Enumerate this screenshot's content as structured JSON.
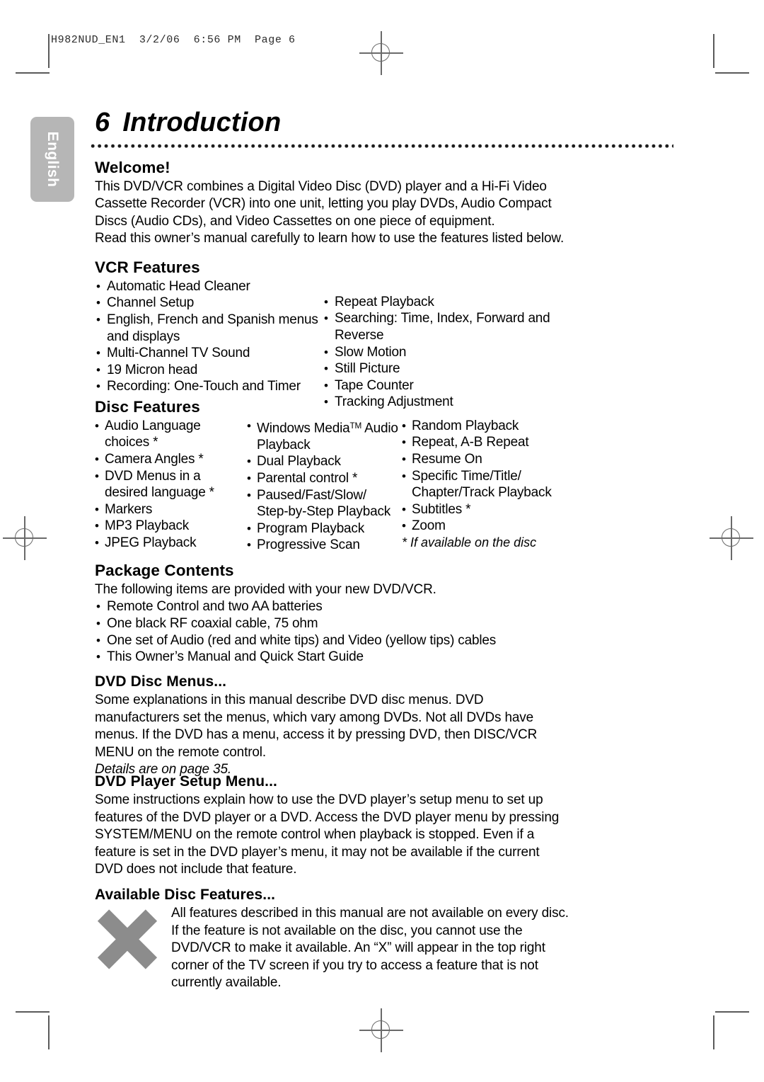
{
  "print_slug": "H982NUD_EN1  3/2/06  6:56 PM  Page 6",
  "language_tab": "English",
  "page": {
    "number": "6",
    "title": "Introduction"
  },
  "sections": {
    "welcome": {
      "heading": "Welcome!",
      "paragraph1": "This DVD/VCR combines a Digital Video Disc (DVD) player and a Hi-Fi Video Cassette Recorder (VCR) into one unit, letting you play DVDs, Audio Compact Discs (Audio CDs), and Video Cassettes on one piece of equipment.",
      "paragraph2": "Read this owner’s manual carefully to learn how to use the features listed below."
    },
    "vcr_features": {
      "heading": "VCR Features",
      "column_left": [
        "Automatic Head Cleaner",
        "Channel Setup",
        "English, French and Spanish menus and displays",
        "Multi-Channel TV Sound",
        "19 Micron head",
        "Recording: One-Touch and Timer"
      ],
      "column_right": [
        "Repeat Playback",
        "Searching: Time, Index, Forward and Reverse",
        "Slow Motion",
        "Still Picture",
        "Tape Counter",
        "Tracking Adjustment"
      ]
    },
    "disc_features": {
      "heading": "Disc Features",
      "column_1": [
        "Audio Language choices *",
        "Camera Angles *",
        "DVD Menus in a desired language *",
        "Markers",
        "MP3 Playback",
        "JPEG Playback"
      ],
      "column_2": [
        "Windows Media™ Audio Playback",
        "Dual Playback",
        "Parental control *",
        "Paused/Fast/Slow/ Step-by-Step Playback",
        "Program Playback",
        "Progressive Scan"
      ],
      "column_3": [
        "Random Playback",
        "Repeat, A-B Repeat",
        "Resume On",
        "Specific Time/Title/ Chapter/Track Playback",
        "Subtitles *",
        "Zoom"
      ],
      "footnote": "* If available on the disc"
    },
    "package_contents": {
      "heading": "Package Contents",
      "intro": "The following items are provided with your new DVD/VCR.",
      "items": [
        "Remote Control and two AA batteries",
        "One black RF coaxial cable, 75 ohm",
        "One set of Audio (red and white tips) and Video (yellow tips) cables",
        "This Owner’s Manual and Quick Start Guide"
      ]
    },
    "dvd_disc_menus": {
      "heading": "DVD Disc Menus...",
      "paragraph": "Some explanations in this manual describe DVD disc menus. DVD manufacturers set the menus, which vary among DVDs. Not all DVDs have menus. If the DVD has a menu, access it by pressing DVD, then DISC/VCR MENU on the remote control.",
      "reference": "Details are on page 35."
    },
    "dvd_player_setup_menu": {
      "heading": "DVD Player Setup Menu...",
      "paragraph": "Some instructions explain how to use the DVD player’s setup menu to set up features of the DVD player or a DVD. Access the DVD player menu by pressing SYSTEM/MENU on the remote control when playback is stopped. Even if a feature is set in the DVD player’s menu, it may not be available if the current DVD does not include that feature."
    },
    "available_disc_features": {
      "heading": "Available Disc Features...",
      "icon": "x-mark-icon",
      "paragraph": "All features described in this manual are not available on every disc. If the feature is not available on the disc, you cannot use the DVD/VCR to make it available. An “X” will appear in the top right corner of the TV screen if you try to access a feature that is not currently available."
    }
  },
  "colors": {
    "language_tab_bg": "#b6b6b6",
    "x_icon": "#8c8c8c",
    "crop_mark": "#5a5a5a",
    "text": "#000000"
  }
}
